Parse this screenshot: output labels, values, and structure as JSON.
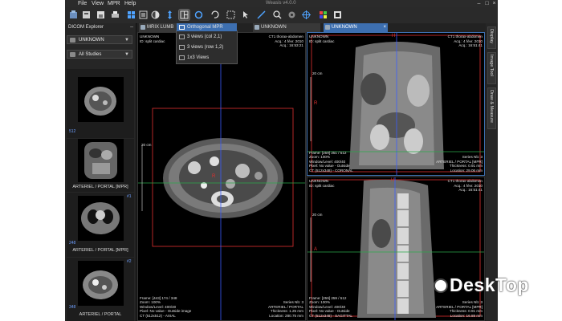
{
  "window": {
    "title": "Weasis v4.0.0"
  },
  "menu": [
    "File",
    "View",
    "MPR",
    "Help"
  ],
  "colors": {
    "accent": "#3d6fb0",
    "crosshair_red": "#e03030",
    "crosshair_blue": "#3a5cff",
    "crosshair_green": "#2aa84a"
  },
  "toolbar": {
    "icons": [
      "import-icon",
      "export-icon",
      "save-icon",
      "print-icon",
      "layout-icon",
      "sync-icon",
      "measure-icon",
      "cursor-icon",
      "rotate-icon",
      "pan-icon",
      "zoom-icon",
      "window-level-icon",
      "reset-icon",
      "crosshair-icon",
      "color-icon",
      "display-icon"
    ]
  },
  "explorer": {
    "title": "DICOM Explorer",
    "patient_select": "UNKNOWN",
    "studies_select": "All Studies",
    "thumbnails": [
      {
        "label": "",
        "count": "512"
      },
      {
        "label": "ARTERIEL / PORTAL [MPR]",
        "count": ""
      },
      {
        "label": "ARTERIEL / PORTAL [MPR]",
        "count": "248"
      },
      {
        "label": "ARTERIEL / PORTAL",
        "count": "348"
      }
    ],
    "series_numbers": [
      "#1",
      "#2"
    ]
  },
  "tabs": [
    {
      "label": "MRIX LUMB",
      "active": false
    },
    {
      "label": "UNKNOWN",
      "active": false
    },
    {
      "label": "UNKNOWN",
      "active": true
    }
  ],
  "layout_menu": {
    "selected": "Orthogonal MPR",
    "items": [
      "3 views (col 2,1)",
      "3 views (row 1,2)",
      "1x3 Views"
    ]
  },
  "views": {
    "axial": {
      "top_left": [
        "UNKNOWN",
        "ID: split cardiac"
      ],
      "top_right": [
        "CT1 thorax-abdomen",
        "Acq.: 4 févr. 2010",
        "Acq.: 16:53:21"
      ],
      "bottom_left": [
        "Frame: [443] 174 / 348",
        "Zoom: 100%",
        "Window/Level: 400/40",
        "Pixel: No value - Outside image",
        "CT (512x512) - AXIAL"
      ],
      "bottom_right": [
        "Series Nb: 3",
        "ARTERIEL / PORTAL",
        "Thickness: 1.25 mm",
        "Location: 280.75 mm"
      ],
      "scale": "20 cm",
      "orient": "R"
    },
    "coronal": {
      "top_left": [
        "UNKNOWN",
        "ID: split cardiac"
      ],
      "top_right": [
        "CT1 thorax-abdomen",
        "Acq.: 4 févr. 2010",
        "Acq.: 16:51:41"
      ],
      "bottom_left": [
        "Frame: [259] 251 / 512",
        "Zoom: 100%",
        "Window/Level: 400/40",
        "Pixel: No value - Outside",
        "CT (512x348) - CORONAL"
      ],
      "bottom_right": [
        "Series Nb: 3",
        "ARTERIEL / PORTAL [MPR]",
        "Thickness: 0.91 mm",
        "Location: 29.06 mm"
      ],
      "scale": "20 cm",
      "orient_top": "H",
      "orient_left": "R"
    },
    "sagittal": {
      "top_left": [
        "UNKNOWN",
        "ID: split cardiac"
      ],
      "top_right": [
        "CT1 thorax-abdomen",
        "Acq.: 4 févr. 2010",
        "Acq.: 16:51:41"
      ],
      "bottom_left": [
        "Frame: [259] 259 / 512",
        "Zoom: 100%",
        "Window/Level: 400/40",
        "Pixel: No value - Outside",
        "CT (512x348) - SAGITTAL"
      ],
      "bottom_right": [
        "Series Nb: 3",
        "ARTERIEL / PORTAL [MPR]",
        "Thickness: 0.91 mm",
        "Location: 16.88 mm"
      ],
      "scale": "20 cm",
      "orient_top": "H",
      "orient_left": "A"
    }
  },
  "right_panels": [
    "Display",
    "Image Tool",
    "Draw & Measure"
  ],
  "watermark": {
    "text": "DeskTop"
  }
}
